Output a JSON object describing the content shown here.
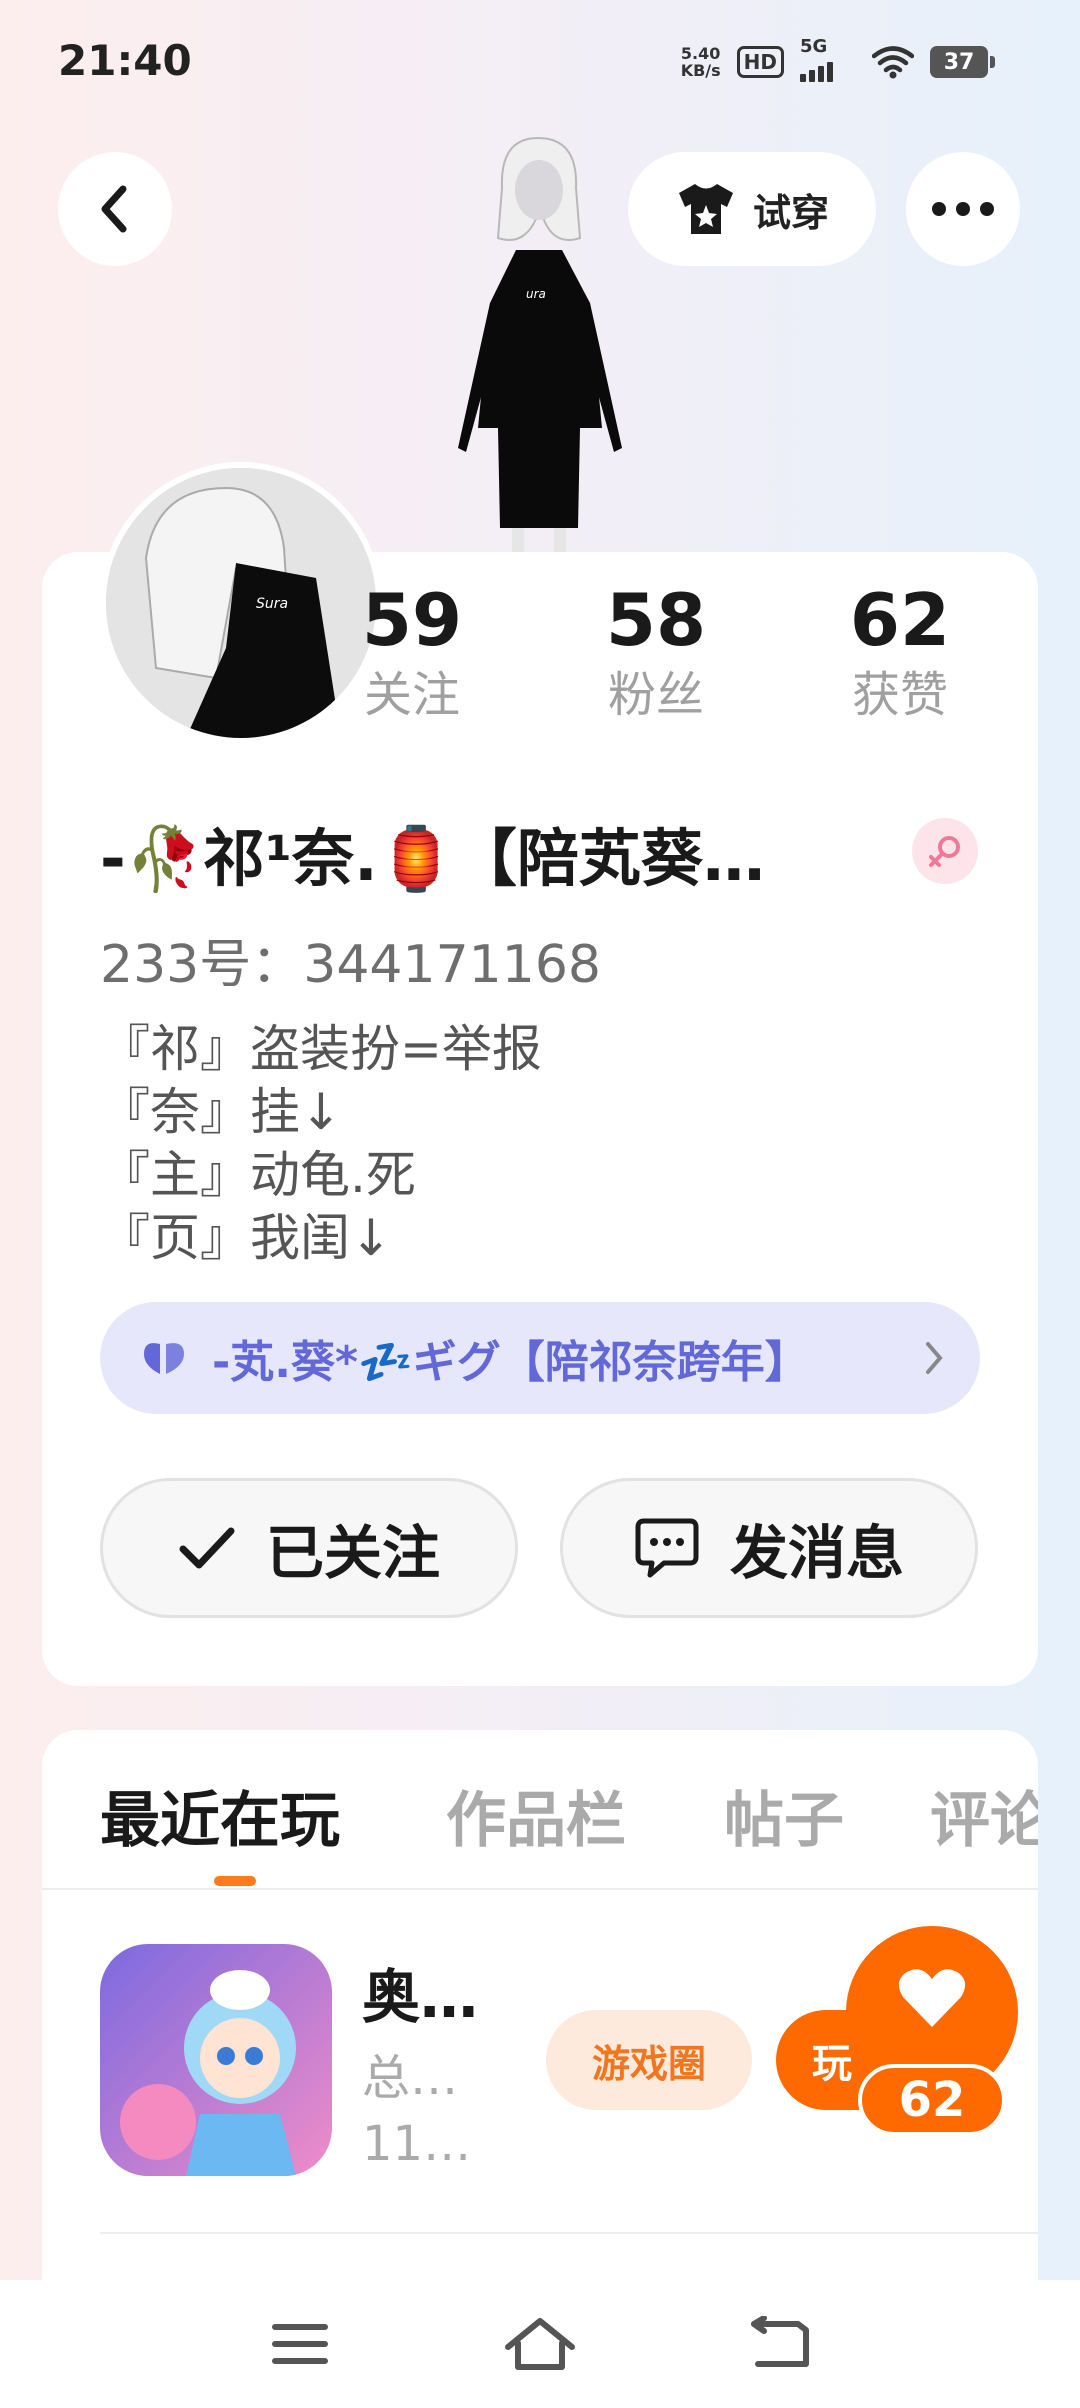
{
  "status_bar": {
    "time": "21:40",
    "net_speed_value": "5.40",
    "net_speed_unit": "KB/s",
    "hd_label": "HD",
    "network_label": "5G",
    "battery": "37"
  },
  "header": {
    "try_on_label": "试穿"
  },
  "profile": {
    "stats": [
      {
        "value": "59",
        "label": "关注"
      },
      {
        "value": "58",
        "label": "粉丝"
      },
      {
        "value": "62",
        "label": "获赞"
      }
    ],
    "nickname": "-🥀祁¹奈.🏮【陪芄葵…",
    "user_id": "233号：344171168",
    "bio_lines": [
      "『祁』盗装扮=举报",
      "『奈』挂↓",
      "『主』动龟.死",
      "『页』我闺↓"
    ],
    "relation_text": "-芄.葵*💤ギグ【陪祁奈跨年】",
    "follow_label": "已关注",
    "message_label": "发消息"
  },
  "tabs": [
    "最近在玩",
    "作品栏",
    "帖子",
    "评论"
  ],
  "game": {
    "title": "奥…",
    "subtitle1": "总…",
    "subtitle2": "11…",
    "circle_label": "游戏圈",
    "play_label": "玩"
  },
  "likes": {
    "count": "62"
  },
  "colors": {
    "accent": "#ff6a00",
    "relation_text": "#6268d8"
  }
}
